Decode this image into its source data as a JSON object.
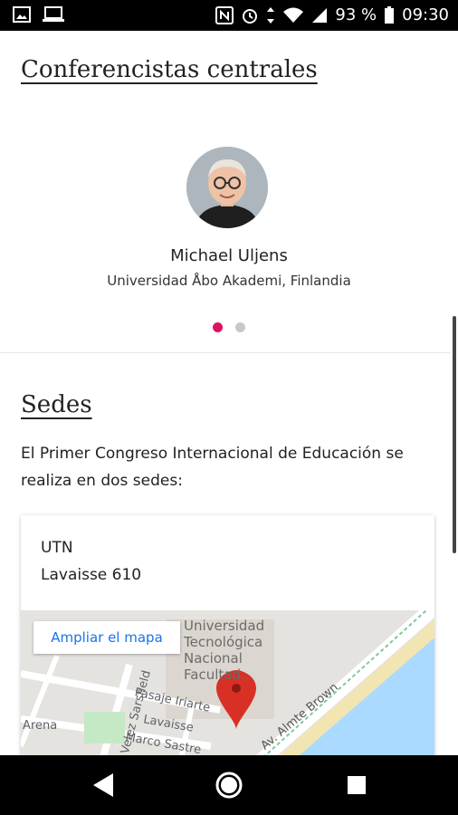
{
  "status_bar": {
    "battery_percent": "93 %",
    "time": "09:30",
    "icons": [
      "image-icon",
      "laptop-icon",
      "nfc-icon",
      "alarm-icon",
      "data-arrows-icon",
      "wifi-icon",
      "signal-icon",
      "battery-icon"
    ]
  },
  "speakers": {
    "title": "Conferencistas centrales",
    "current": {
      "name": "Michael Uljens",
      "affiliation": "Universidad Åbo Akademi, Finlandia"
    },
    "pager": {
      "total": 2,
      "active": 1,
      "active_color": "#e0115f",
      "inactive_color": "#c8c8c8"
    }
  },
  "venues": {
    "title": "Sedes",
    "description": "El Primer Congreso Internacional de Educación se realiza en dos sedes:",
    "card": {
      "name": "UTN",
      "address": "Lavaisse 610",
      "map": {
        "enlarge_label": "Ampliar el mapa",
        "poi_lines": [
          "Universidad",
          "Tecnológica",
          "Nacional",
          "Facultad..."
        ],
        "streets": [
          "Av. Almte Brown",
          "Velez Sarsfield",
          "Pasaje Iriarte",
          "Lavaisse",
          "Marco Sastre",
          "Arena"
        ],
        "marker_color": "#d93025"
      }
    }
  },
  "nav_bar": {
    "buttons": [
      "back-icon",
      "home-icon",
      "recents-icon"
    ]
  }
}
